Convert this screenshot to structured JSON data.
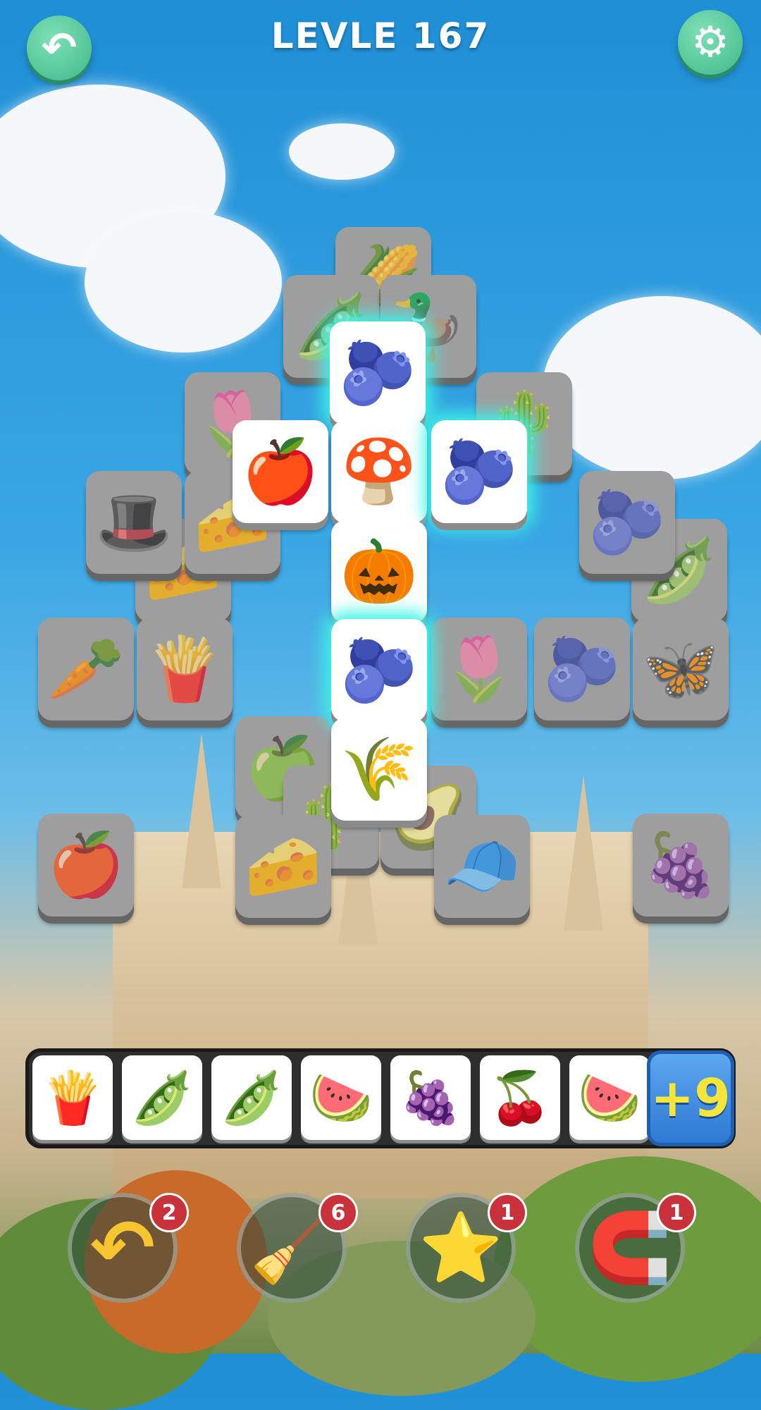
{
  "header": {
    "title": "LEVLE 167",
    "back_icon": "back-arrow-icon",
    "settings_icon": "gear-icon"
  },
  "board": {
    "tiles": [
      {
        "name": "corn",
        "glyph": "🌽",
        "state": "blocked"
      },
      {
        "name": "green-bean",
        "glyph": "🫛",
        "state": "blocked"
      },
      {
        "name": "rubber-duck",
        "glyph": "🦆",
        "state": "blocked"
      },
      {
        "name": "tulip",
        "glyph": "🌷",
        "state": "blocked"
      },
      {
        "name": "cactus",
        "glyph": "🌵",
        "state": "blocked"
      },
      {
        "name": "blueberry",
        "glyph": "🫐",
        "state": "highlighted"
      },
      {
        "name": "apple",
        "glyph": "🍎",
        "state": "free"
      },
      {
        "name": "mushroom",
        "glyph": "🍄",
        "state": "free"
      },
      {
        "name": "blueberry",
        "glyph": "🫐",
        "state": "highlighted"
      },
      {
        "name": "hat",
        "glyph": "🎩",
        "state": "blocked"
      },
      {
        "name": "cheese",
        "glyph": "🧀",
        "state": "blocked"
      },
      {
        "name": "blueberry",
        "glyph": "🫐",
        "state": "blocked"
      },
      {
        "name": "cheese",
        "glyph": "🧀",
        "state": "blocked"
      },
      {
        "name": "pumpkin",
        "glyph": "🎃",
        "state": "free"
      },
      {
        "name": "green-bean",
        "glyph": "🫛",
        "state": "blocked"
      },
      {
        "name": "carrot",
        "glyph": "🥕",
        "state": "blocked"
      },
      {
        "name": "fries",
        "glyph": "🍟",
        "state": "blocked"
      },
      {
        "name": "blueberry",
        "glyph": "🫐",
        "state": "highlighted"
      },
      {
        "name": "tulip",
        "glyph": "🌷",
        "state": "blocked"
      },
      {
        "name": "blueberry",
        "glyph": "🫐",
        "state": "blocked"
      },
      {
        "name": "butterfly",
        "glyph": "🦋",
        "state": "blocked"
      },
      {
        "name": "leaf",
        "glyph": "🌾",
        "state": "free"
      },
      {
        "name": "apple",
        "glyph": "🍏",
        "state": "blocked"
      },
      {
        "name": "cactus",
        "glyph": "🌵",
        "state": "blocked"
      },
      {
        "name": "avocado",
        "glyph": "🥑",
        "state": "blocked"
      },
      {
        "name": "apple",
        "glyph": "🍎",
        "state": "blocked"
      },
      {
        "name": "cheese",
        "glyph": "🧀",
        "state": "blocked"
      },
      {
        "name": "hat",
        "glyph": "🧢",
        "state": "blocked"
      },
      {
        "name": "grapes",
        "glyph": "🍇",
        "state": "blocked"
      }
    ]
  },
  "tray": {
    "slots": [
      {
        "name": "fries",
        "glyph": "🍟"
      },
      {
        "name": "green-bean",
        "glyph": "🫛"
      },
      {
        "name": "green-bean",
        "glyph": "🫛"
      },
      {
        "name": "watermelon",
        "glyph": "🍉"
      },
      {
        "name": "grapes",
        "glyph": "🍇"
      },
      {
        "name": "cherries",
        "glyph": "🍒"
      },
      {
        "name": "watermelon",
        "glyph": "🍉"
      }
    ],
    "extra_label": "+9"
  },
  "boosters": [
    {
      "name": "undo",
      "icon": "undo-arrow-icon",
      "glyph": "↶",
      "count": "2"
    },
    {
      "name": "sweep",
      "icon": "broom-icon",
      "glyph": "🧹",
      "count": "6"
    },
    {
      "name": "magic-wand",
      "icon": "star-wand-icon",
      "glyph": "⭐",
      "count": "1"
    },
    {
      "name": "magnet",
      "icon": "magnet-icon",
      "glyph": "🧲",
      "count": "1"
    }
  ]
}
